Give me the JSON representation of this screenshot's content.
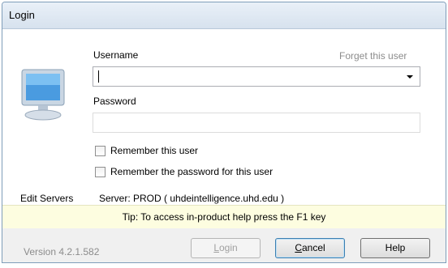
{
  "window": {
    "title": "Login"
  },
  "username": {
    "label": "Username",
    "value": "",
    "forget_link": "Forget this user"
  },
  "password": {
    "label": "Password",
    "value": ""
  },
  "options": {
    "remember_user": "Remember this user",
    "remember_password": "Remember the password for this user"
  },
  "servers": {
    "edit_label": "Edit Servers",
    "server_text": "Server: PROD ( uhdeintelligence.uhd.edu )"
  },
  "tip": "Tip: To access in-product help press the F1 key",
  "footer": {
    "version": "Version 4.2.1.582",
    "login_prefix": "L",
    "login_rest": "ogin",
    "cancel_prefix": "C",
    "cancel_rest": "ancel",
    "help_label": "Help"
  }
}
